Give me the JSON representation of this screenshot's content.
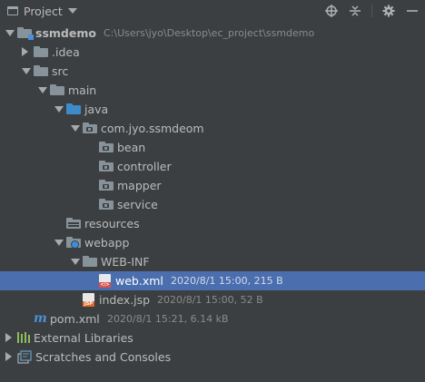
{
  "header": {
    "title": "Project",
    "tools": [
      "crosshair-icon",
      "collapse-all-icon",
      "gear-icon",
      "hide-icon"
    ]
  },
  "tree": [
    {
      "id": "ssmdemo",
      "label": "ssmdemo",
      "path": "C:\\Users\\jyo\\Desktop\\ec_project\\ssmdemo",
      "meta": "",
      "depth": 0,
      "arrow": "down",
      "icon": "module-folder",
      "bold": true
    },
    {
      "id": "idea",
      "label": ".idea",
      "path": "",
      "meta": "",
      "depth": 1,
      "arrow": "right",
      "icon": "folder"
    },
    {
      "id": "src",
      "label": "src",
      "path": "",
      "meta": "",
      "depth": 1,
      "arrow": "down",
      "icon": "folder"
    },
    {
      "id": "main",
      "label": "main",
      "path": "",
      "meta": "",
      "depth": 2,
      "arrow": "down",
      "icon": "folder"
    },
    {
      "id": "java",
      "label": "java",
      "path": "",
      "meta": "",
      "depth": 3,
      "arrow": "down",
      "icon": "source-folder"
    },
    {
      "id": "pkg",
      "label": "com.jyo.ssmdeom",
      "path": "",
      "meta": "",
      "depth": 4,
      "arrow": "down",
      "icon": "package-folder"
    },
    {
      "id": "bean",
      "label": "bean",
      "path": "",
      "meta": "",
      "depth": 5,
      "arrow": "",
      "icon": "package-folder"
    },
    {
      "id": "controller",
      "label": "controller",
      "path": "",
      "meta": "",
      "depth": 5,
      "arrow": "",
      "icon": "package-folder"
    },
    {
      "id": "mapper",
      "label": "mapper",
      "path": "",
      "meta": "",
      "depth": 5,
      "arrow": "",
      "icon": "package-folder"
    },
    {
      "id": "service",
      "label": "service",
      "path": "",
      "meta": "",
      "depth": 5,
      "arrow": "",
      "icon": "package-folder"
    },
    {
      "id": "resources",
      "label": "resources",
      "path": "",
      "meta": "",
      "depth": 3,
      "arrow": "",
      "icon": "resources-folder"
    },
    {
      "id": "webapp",
      "label": "webapp",
      "path": "",
      "meta": "",
      "depth": 3,
      "arrow": "down",
      "icon": "web-folder"
    },
    {
      "id": "webinf",
      "label": "WEB-INF",
      "path": "",
      "meta": "",
      "depth": 4,
      "arrow": "down",
      "icon": "folder"
    },
    {
      "id": "webxml",
      "label": "web.xml",
      "path": "",
      "meta": "2020/8/1 15:00, 215 B",
      "depth": 5,
      "arrow": "",
      "icon": "xml-file",
      "selected": true
    },
    {
      "id": "indexjsp",
      "label": "index.jsp",
      "path": "",
      "meta": "2020/8/1 15:00, 52 B",
      "depth": 4,
      "arrow": "",
      "icon": "jsp-file"
    },
    {
      "id": "pom",
      "label": "pom.xml",
      "path": "",
      "meta": "2020/8/1 15:21, 6.14 kB",
      "depth": 1,
      "arrow": "",
      "icon": "maven-file"
    },
    {
      "id": "extlib",
      "label": "External Libraries",
      "path": "",
      "meta": "",
      "depth": 0,
      "arrow": "right",
      "icon": "libraries"
    },
    {
      "id": "scratch",
      "label": "Scratches and Consoles",
      "path": "",
      "meta": "",
      "depth": 0,
      "arrow": "right",
      "icon": "scratches"
    }
  ]
}
